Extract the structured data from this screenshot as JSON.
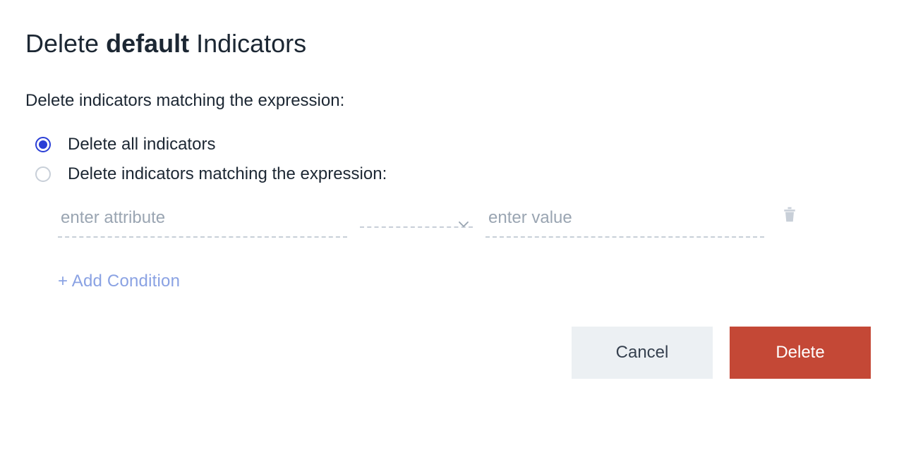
{
  "title": {
    "prefix": "Delete ",
    "emphasis": "default",
    "suffix": " Indicators"
  },
  "subtitle": "Delete indicators matching the expression:",
  "options": {
    "all": {
      "label": "Delete all indicators",
      "selected": true
    },
    "matching": {
      "label": "Delete indicators matching the expression:",
      "selected": false
    }
  },
  "condition": {
    "attribute_placeholder": "enter attribute",
    "attribute_value": "",
    "operator_value": "",
    "value_placeholder": "enter value",
    "value_value": ""
  },
  "add_condition_label": "+ Add Condition",
  "buttons": {
    "cancel": "Cancel",
    "delete": "Delete"
  }
}
